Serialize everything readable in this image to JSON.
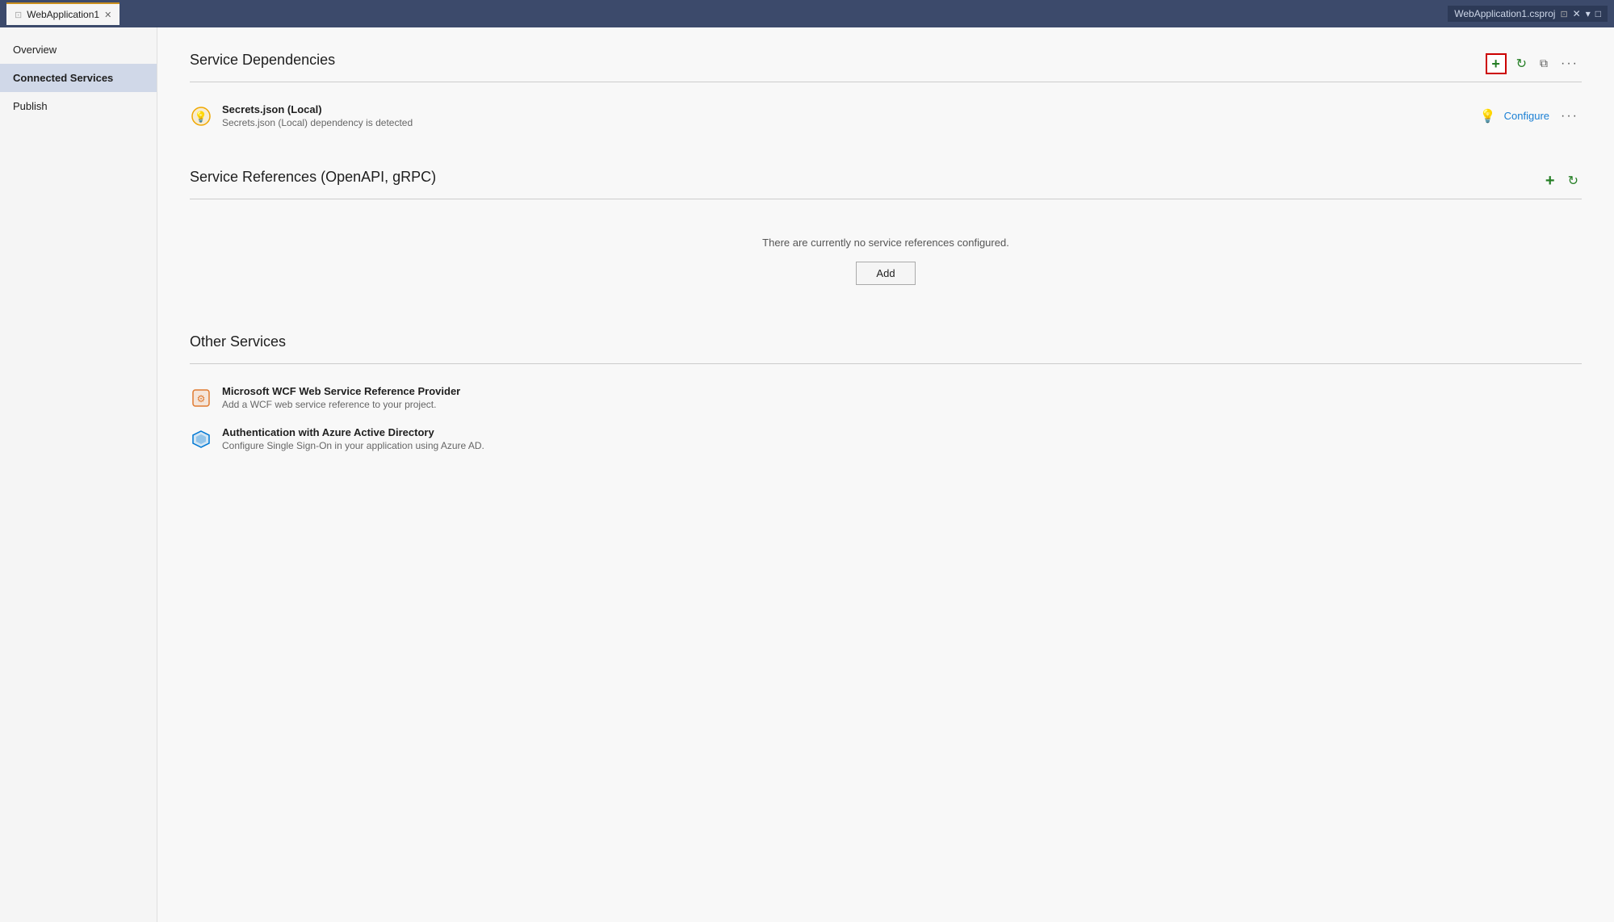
{
  "titleBar": {
    "tab_label": "WebApplication1",
    "tab_pin": "📌",
    "tab_close": "✕",
    "project_name": "WebApplication1.csproj",
    "project_pin": "📌",
    "project_close": "✕",
    "chevron_down": "▾",
    "maximize": "□"
  },
  "sidebar": {
    "items": [
      {
        "id": "overview",
        "label": "Overview",
        "active": false
      },
      {
        "id": "connected-services",
        "label": "Connected Services",
        "active": true
      },
      {
        "id": "publish",
        "label": "Publish",
        "active": false
      }
    ]
  },
  "serviceDependencies": {
    "title": "Service Dependencies",
    "items": [
      {
        "id": "secrets-json",
        "name": "Secrets.json (Local)",
        "description": "Secrets.json (Local) dependency is detected",
        "configure_label": "Configure"
      }
    ]
  },
  "serviceReferences": {
    "title": "Service References (OpenAPI, gRPC)",
    "empty_message": "There are currently no service references configured.",
    "add_button_label": "Add"
  },
  "otherServices": {
    "title": "Other Services",
    "items": [
      {
        "id": "wcf",
        "name": "Microsoft WCF Web Service Reference Provider",
        "description": "Add a WCF web service reference to your project."
      },
      {
        "id": "azure-ad",
        "name": "Authentication with Azure Active Directory",
        "description": "Configure Single Sign-On in your application using Azure AD."
      }
    ]
  },
  "icons": {
    "bulb": "💡",
    "plus": "+",
    "refresh": "↻",
    "share": "⧉",
    "dots": "···",
    "wcf": "⚙",
    "azure": "◇"
  }
}
